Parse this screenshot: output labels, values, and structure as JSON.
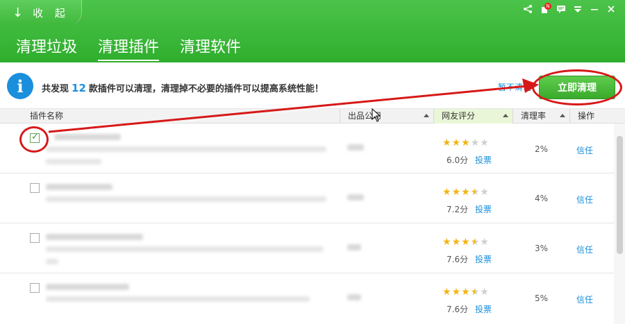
{
  "header": {
    "collapse_label": "收 起",
    "tabs": [
      {
        "label": "清理垃圾",
        "active": false
      },
      {
        "label": "清理插件",
        "active": true
      },
      {
        "label": "清理软件",
        "active": false
      }
    ],
    "notify_badge": "N",
    "controls": [
      "share-icon",
      "notification-icon",
      "message-icon",
      "menu-icon",
      "minimize-icon",
      "close-icon"
    ]
  },
  "info": {
    "prefix": "共发现",
    "count": "12",
    "suffix": "款插件可以清理，清理掉不必要的插件可以提高系统性能！",
    "pause_link": "暂不清理",
    "clean_button": "立即清理"
  },
  "table": {
    "columns": [
      "插件名称",
      "出品公司",
      "网友评分",
      "清理率",
      "操作"
    ],
    "sorted_column": "网友评分",
    "rows": [
      {
        "checked": true,
        "stars": [
          1,
          1,
          1,
          0,
          0
        ],
        "score": "6.0分",
        "vote": "投票",
        "rate": "2%",
        "action": "信任"
      },
      {
        "checked": false,
        "stars": [
          1,
          1,
          1,
          0.5,
          0
        ],
        "score": "7.2分",
        "vote": "投票",
        "rate": "4%",
        "action": "信任"
      },
      {
        "checked": false,
        "stars": [
          1,
          1,
          1,
          0.5,
          0
        ],
        "score": "7.6分",
        "vote": "投票",
        "rate": "3%",
        "action": "信任"
      },
      {
        "checked": false,
        "stars": [
          1,
          1,
          1,
          0.5,
          0
        ],
        "score": "7.6分",
        "vote": "投票",
        "rate": "5%",
        "action": "信任"
      }
    ]
  },
  "colors": {
    "brand_green": "#3ab838",
    "link_blue": "#1a8fdc",
    "annotation_red": "#d71818",
    "star_gold": "#f1b413"
  }
}
